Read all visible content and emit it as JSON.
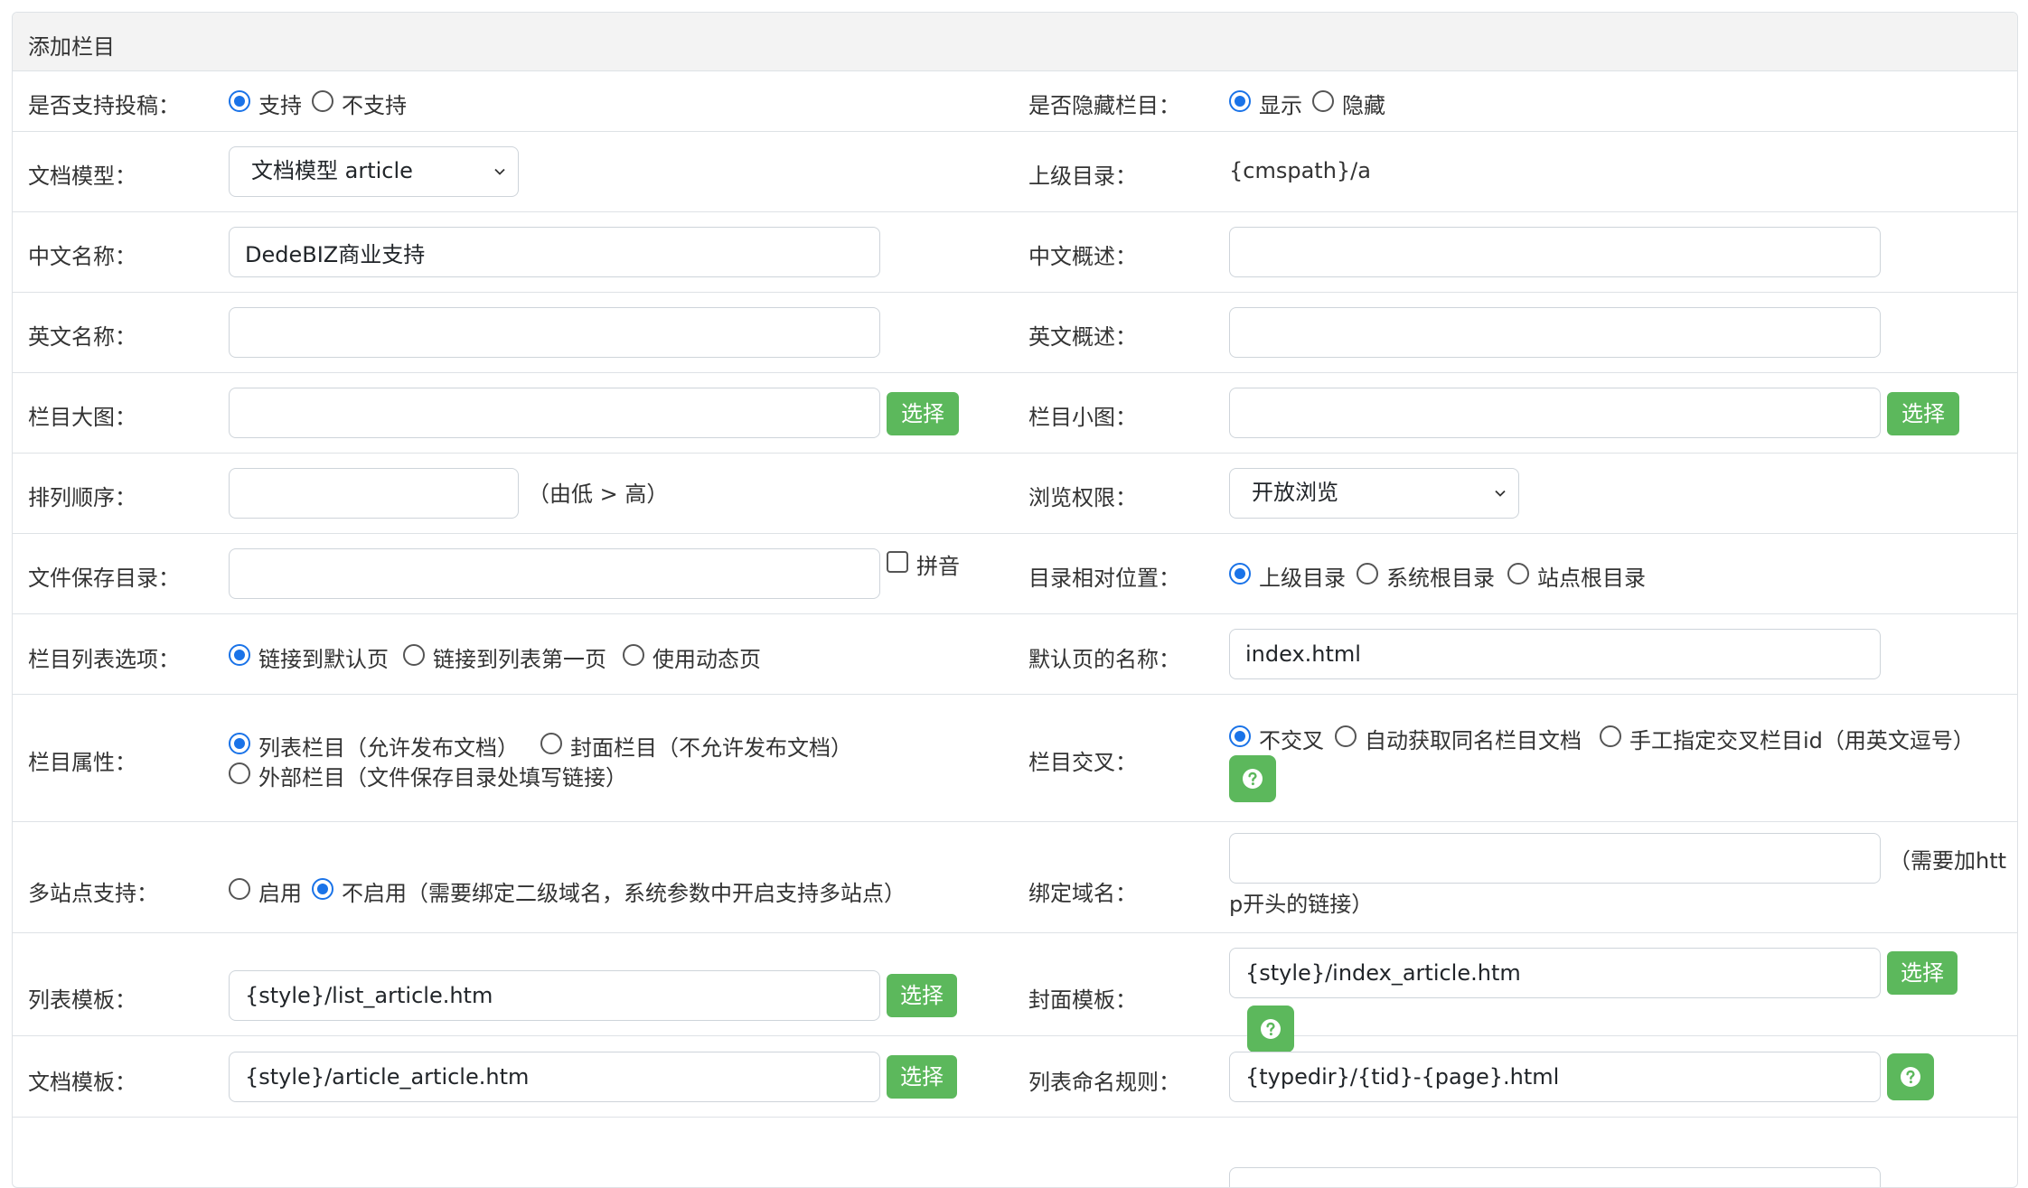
{
  "panel_title": "添加栏目",
  "fields": {
    "contribute": {
      "label": "是否支持投稿：",
      "options": [
        "支持",
        "不支持"
      ],
      "selected": 0
    },
    "hidden": {
      "label": "是否隐藏栏目：",
      "options": [
        "显示",
        "隐藏"
      ],
      "selected": 0
    },
    "doc_model": {
      "label": "文档模型：",
      "value": "文档模型 article"
    },
    "parent_dir": {
      "label": "上级目录：",
      "value": "{cmspath}/a"
    },
    "cn_name": {
      "label": "中文名称：",
      "value": "DedeBIZ商业支持"
    },
    "cn_desc": {
      "label": "中文概述：",
      "value": ""
    },
    "en_name": {
      "label": "英文名称：",
      "value": ""
    },
    "en_desc": {
      "label": "英文概述：",
      "value": ""
    },
    "big_pic": {
      "label": "栏目大图：",
      "value": "",
      "button": "选择"
    },
    "small_pic": {
      "label": "栏目小图：",
      "value": "",
      "button": "选择"
    },
    "sort_order": {
      "label": "排列顺序：",
      "value": "",
      "hint": "（由低 > 高）"
    },
    "browse_perm": {
      "label": "浏览权限：",
      "value": "开放浏览"
    },
    "save_dir": {
      "label": "文件保存目录：",
      "value": "",
      "checkbox_label": "拼音"
    },
    "dir_position": {
      "label": "目录相对位置：",
      "options": [
        "上级目录",
        "系统根目录",
        "站点根目录"
      ],
      "selected": 0
    },
    "list_option": {
      "label": "栏目列表选项：",
      "options": [
        "链接到默认页",
        "链接到列表第一页",
        "使用动态页"
      ],
      "selected": 0
    },
    "default_page": {
      "label": "默认页的名称：",
      "value": "index.html"
    },
    "attr": {
      "label": "栏目属性：",
      "options": [
        "列表栏目（允许发布文档）",
        "封面栏目（不允许发布文档）",
        "外部栏目（文件保存目录处填写链接）"
      ],
      "selected": 0
    },
    "cross": {
      "label": "栏目交叉：",
      "options": [
        "不交叉",
        "自动获取同名栏目文档",
        "手工指定交叉栏目id（用英文逗号）"
      ],
      "selected": 0
    },
    "multisite": {
      "label": "多站点支持：",
      "options": [
        "启用",
        "不启用（需要绑定二级域名，系统参数中开启支持多站点）"
      ],
      "selected": 1
    },
    "bind_domain": {
      "label": "绑定域名：",
      "value": "",
      "hint_line1": "（需要加htt",
      "hint_line2": "p开头的链接）"
    },
    "list_tpl": {
      "label": "列表模板：",
      "value": "{style}/list_article.htm",
      "button": "选择"
    },
    "cover_tpl": {
      "label": "封面模板：",
      "value": "{style}/index_article.htm",
      "button": "选择"
    },
    "doc_tpl": {
      "label": "文档模板：",
      "value": "{style}/article_article.htm",
      "button": "选择"
    },
    "list_rule": {
      "label": "列表命名规则：",
      "value": "{typedir}/{tid}-{page}.html"
    }
  },
  "colors": {
    "accent": "#5cb85c",
    "radio_active": "#1a73e8",
    "border": "#dee2e6",
    "header_bg": "#f3f3f3"
  },
  "icons": {
    "help": "question-circle-icon",
    "select": "chevron-down-icon"
  }
}
